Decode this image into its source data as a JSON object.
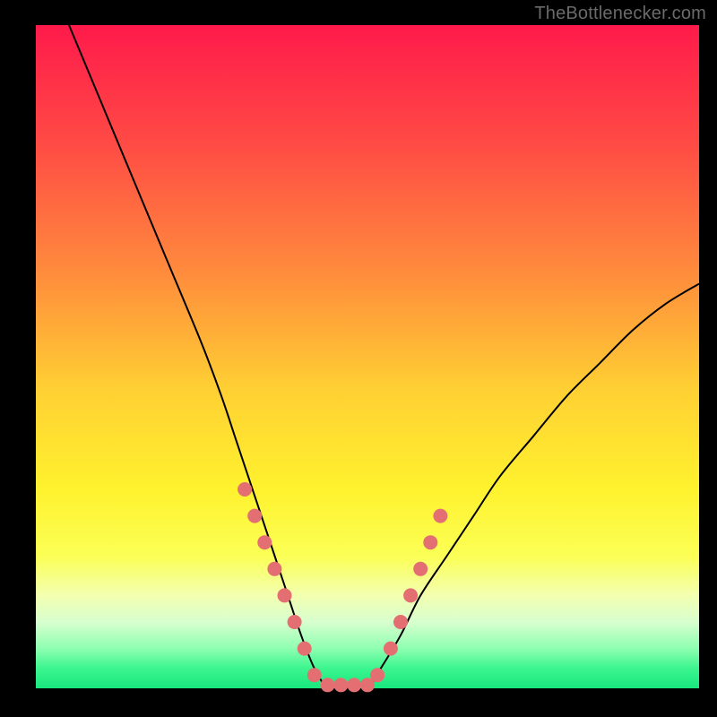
{
  "watermark": "TheBottlenecker.com",
  "gradient_stops": [
    {
      "offset": 0.0,
      "color": "#ff1a4b"
    },
    {
      "offset": 0.18,
      "color": "#ff4b45"
    },
    {
      "offset": 0.38,
      "color": "#ff8e3c"
    },
    {
      "offset": 0.55,
      "color": "#ffd033"
    },
    {
      "offset": 0.7,
      "color": "#fff22e"
    },
    {
      "offset": 0.8,
      "color": "#fbff55"
    },
    {
      "offset": 0.86,
      "color": "#f3ffb0"
    },
    {
      "offset": 0.9,
      "color": "#d8ffcf"
    },
    {
      "offset": 0.94,
      "color": "#8dffb0"
    },
    {
      "offset": 0.97,
      "color": "#3cf58f"
    },
    {
      "offset": 1.0,
      "color": "#18e87e"
    }
  ],
  "curve_color": "#000000",
  "curve_width": 2,
  "marker_color": "#e46f73",
  "marker_radius": 8,
  "chart_data": {
    "type": "line",
    "title": "",
    "xlabel": "",
    "ylabel": "",
    "xlim": [
      0,
      100
    ],
    "ylim": [
      0,
      100
    ],
    "series": [
      {
        "name": "bottleneck-curve",
        "x": [
          5,
          10,
          15,
          20,
          25,
          28,
          30,
          32,
          34,
          36,
          38,
          40,
          42,
          44,
          46,
          48,
          50,
          52,
          55,
          58,
          62,
          66,
          70,
          75,
          80,
          85,
          90,
          95,
          100
        ],
        "y": [
          100,
          88,
          76,
          64,
          52,
          44,
          38,
          32,
          26,
          20,
          14,
          8,
          3,
          0,
          0,
          0,
          0,
          3,
          8,
          14,
          20,
          26,
          32,
          38,
          44,
          49,
          54,
          58,
          61
        ]
      }
    ],
    "markers": {
      "name": "highlight-points",
      "x": [
        31.5,
        33.0,
        34.5,
        36.0,
        37.5,
        39.0,
        40.5,
        42.0,
        44.0,
        46.0,
        48.0,
        50.0,
        51.5,
        53.5,
        55.0,
        56.5,
        58.0,
        59.5,
        61.0
      ],
      "y": [
        30.0,
        26.0,
        22.0,
        18.0,
        14.0,
        10.0,
        6.0,
        2.0,
        0.5,
        0.5,
        0.5,
        0.5,
        2.0,
        6.0,
        10.0,
        14.0,
        18.0,
        22.0,
        26.0
      ]
    }
  }
}
